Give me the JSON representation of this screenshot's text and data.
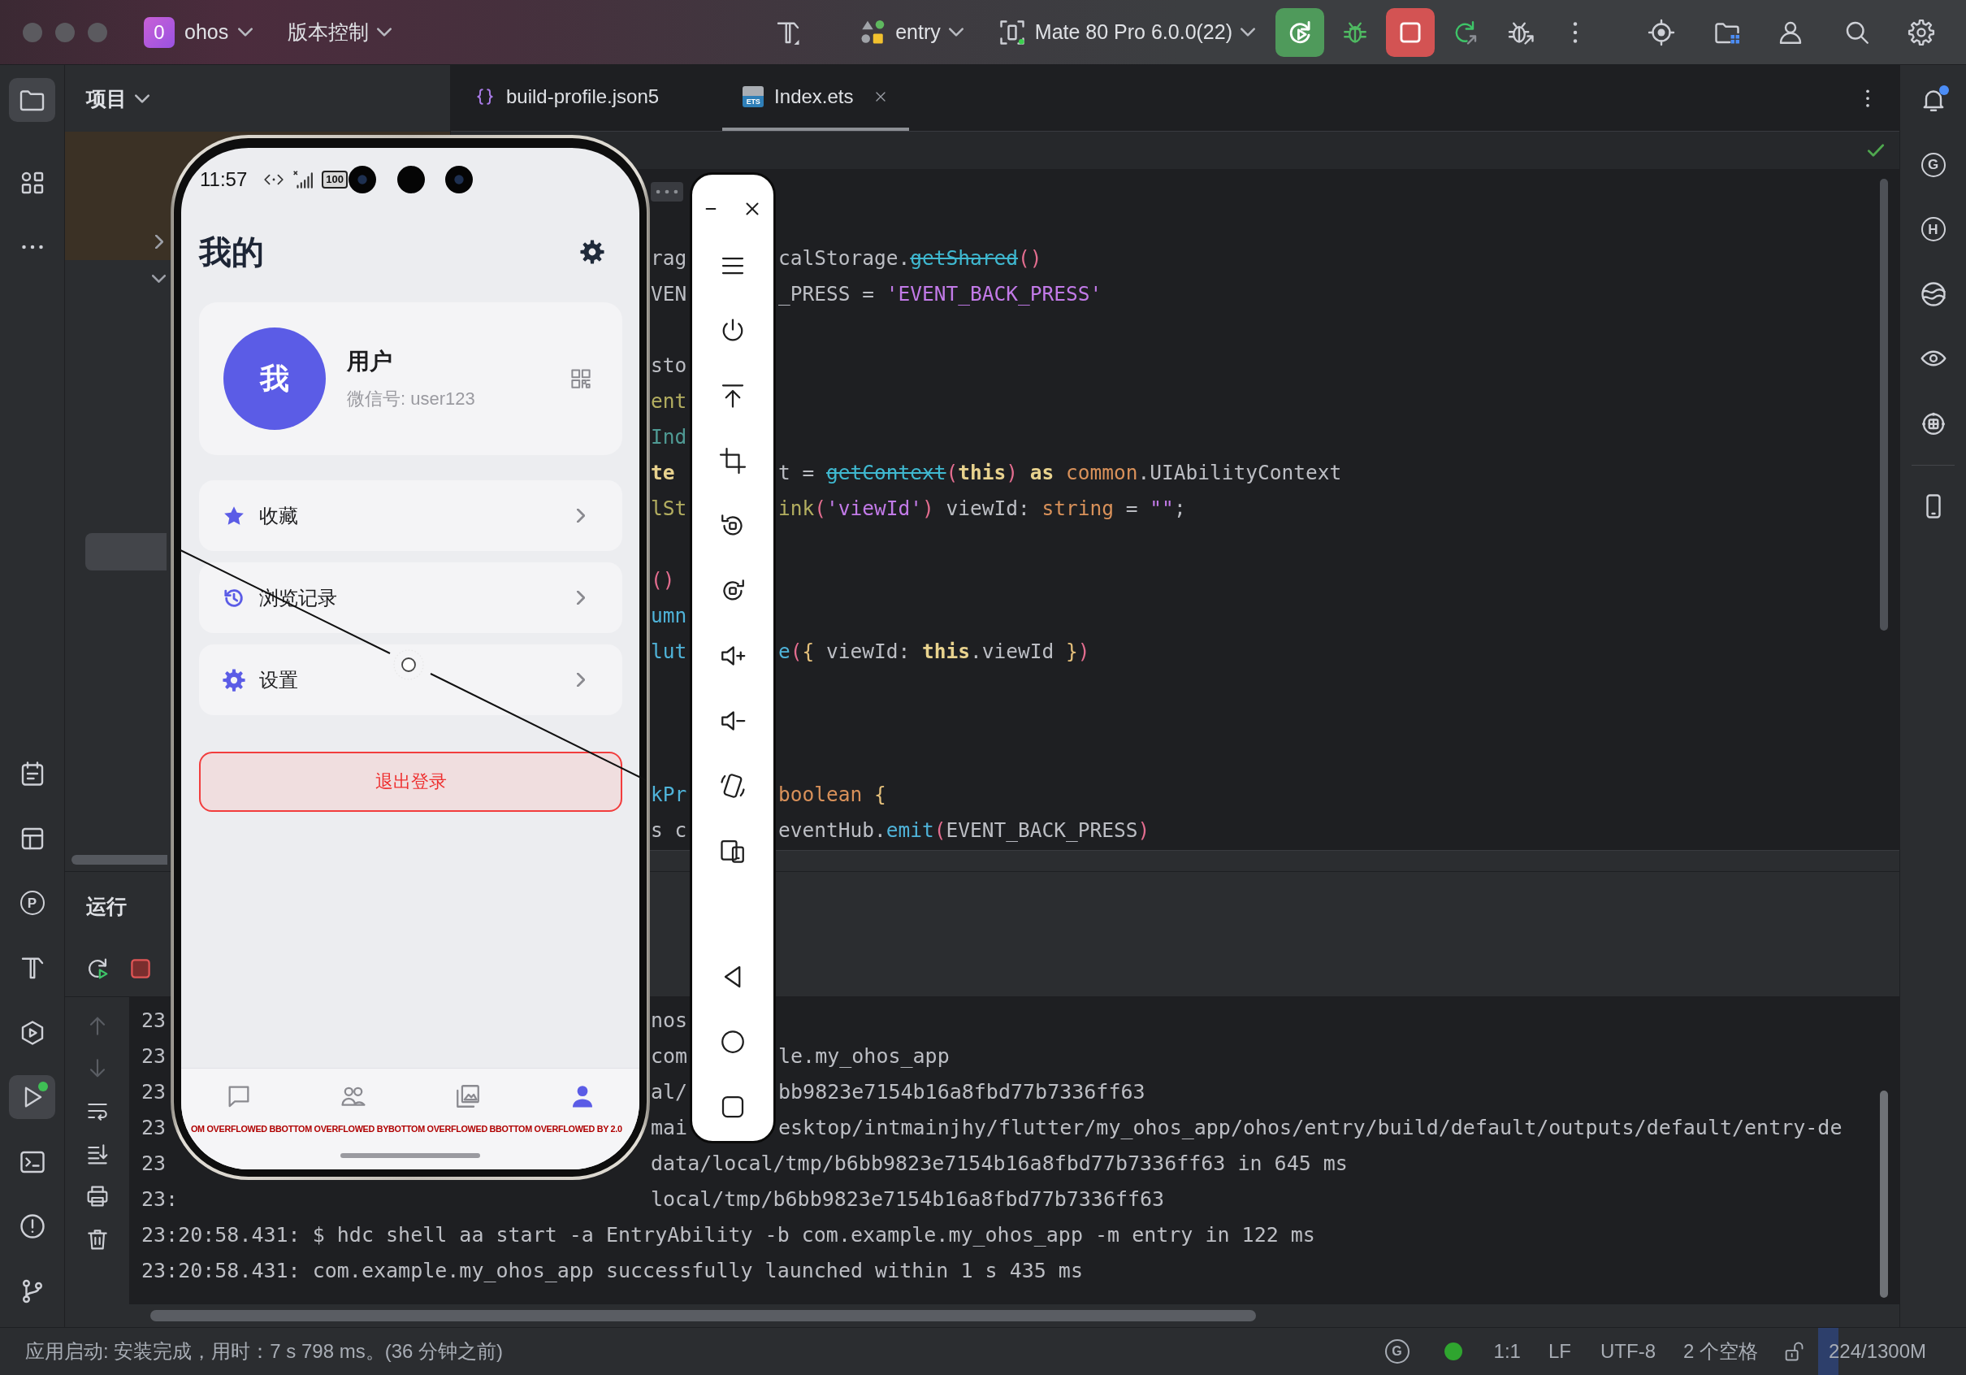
{
  "title_bar": {
    "project_badge": "0",
    "project": "ohos",
    "vcs": "版本控制",
    "run_config": "entry",
    "device": "Mate 80 Pro 6.0.0(22)"
  },
  "left_toolbar": {
    "top": [
      {
        "selected": true
      },
      {
        "selected": false
      },
      {
        "selected": false
      }
    ],
    "bottom": [
      {
        "selected": false,
        "badge": false
      },
      {
        "selected": false,
        "badge": false
      },
      {
        "selected": false,
        "badge": false,
        "letter": "P"
      },
      {
        "selected": false,
        "badge": false
      },
      {
        "selected": false,
        "badge": false
      },
      {
        "selected": true,
        "badge": true
      },
      {
        "selected": false,
        "badge": false
      },
      {
        "selected": false,
        "badge": false
      },
      {
        "selected": false,
        "badge": false
      }
    ]
  },
  "right_toolbar": [
    {
      "badge": true
    },
    {
      "badge": false,
      "letter": "G"
    },
    {
      "badge": false,
      "letter": "H"
    },
    {
      "badge": false
    },
    {
      "badge": false
    },
    {
      "badge": false
    },
    {
      "badge": false
    }
  ],
  "project_panel": {
    "title": "项目"
  },
  "editor_tabs": [
    {
      "kind": "json",
      "label": "build-profile.json5",
      "selected": false
    },
    {
      "kind": "ets",
      "file_type": "ETS",
      "label": "Index.ets",
      "selected": true
    }
  ],
  "code_lines": [
    {
      "kind": "code",
      "left": [
        {
          "text": "rag",
          "kind": "plain"
        }
      ],
      "right": [
        {
          "text": "calStorage.",
          "kind": "plain"
        },
        {
          "text": "getShared",
          "kind": "deprecated"
        },
        {
          "text": "()",
          "kind": "bracket"
        }
      ]
    },
    {
      "kind": "code",
      "left": [
        {
          "text": "VEN",
          "kind": "plain"
        }
      ],
      "right": [
        {
          "text": "_PRESS = ",
          "kind": "plain"
        },
        {
          "text": "'EVENT_BACK_PRESS'",
          "kind": "string"
        }
      ]
    },
    {
      "kind": "blank"
    },
    {
      "kind": "code",
      "left": [
        {
          "text": "sto",
          "kind": "plain"
        }
      ]
    },
    {
      "kind": "code",
      "left": [
        {
          "text": "ent",
          "kind": "decorator"
        }
      ]
    },
    {
      "kind": "code",
      "left": [
        {
          "text": "Ind",
          "kind": "struct"
        }
      ]
    },
    {
      "kind": "code",
      "left": [
        {
          "text": "te",
          "kind": "keyword"
        }
      ],
      "right": [
        {
          "text": "t = ",
          "kind": "plain"
        },
        {
          "text": "getContext",
          "kind": "deprecated"
        },
        {
          "text": "(",
          "kind": "bracket"
        },
        {
          "text": "this",
          "kind": "keyword"
        },
        {
          "text": ") ",
          "kind": "bracket"
        },
        {
          "text": "as ",
          "kind": "keyword"
        },
        {
          "text": "common",
          "kind": "type"
        },
        {
          "text": ".UIAbilityContext",
          "kind": "plain"
        }
      ]
    },
    {
      "kind": "code",
      "left": [
        {
          "text": "lSt",
          "kind": "decorator"
        }
      ],
      "right": [
        {
          "text": "ink",
          "kind": "decorator"
        },
        {
          "text": "(",
          "kind": "bracket"
        },
        {
          "text": "'viewId'",
          "kind": "string"
        },
        {
          "text": ")",
          "kind": "bracket"
        },
        {
          "text": " viewId: ",
          "kind": "plain"
        },
        {
          "text": "string",
          "kind": "type"
        },
        {
          "text": " = ",
          "kind": "plain"
        },
        {
          "text": "\"\"",
          "kind": "string"
        },
        {
          "text": ";",
          "kind": "plain"
        }
      ]
    },
    {
      "kind": "blank"
    },
    {
      "kind": "code",
      "left": [
        {
          "text": "()",
          "kind": "bracket"
        }
      ]
    },
    {
      "kind": "code",
      "left": [
        {
          "text": "umn",
          "kind": "function"
        }
      ]
    },
    {
      "kind": "code",
      "left": [
        {
          "text": "lut",
          "kind": "function"
        }
      ],
      "right": [
        {
          "text": "e",
          "kind": "function"
        },
        {
          "text": "(",
          "kind": "bracket"
        },
        {
          "text": "{",
          "kind": "brace"
        },
        {
          "text": " viewId: ",
          "kind": "plain"
        },
        {
          "text": "this",
          "kind": "keyword"
        },
        {
          "text": ".viewId ",
          "kind": "plain"
        },
        {
          "text": "}",
          "kind": "brace"
        },
        {
          "text": ")",
          "kind": "bracket"
        }
      ]
    },
    {
      "kind": "blank"
    },
    {
      "kind": "blank"
    },
    {
      "kind": "blank"
    },
    {
      "kind": "code",
      "left": [
        {
          "text": "kPr",
          "kind": "function"
        }
      ],
      "right": [
        {
          "text": "boolean ",
          "kind": "type"
        },
        {
          "text": "{",
          "kind": "brace"
        }
      ]
    },
    {
      "kind": "code",
      "left": [
        {
          "text": "s c",
          "kind": "plain"
        }
      ],
      "right": [
        {
          "text": "eventHub.",
          "kind": "plain"
        },
        {
          "text": "emit",
          "kind": "function"
        },
        {
          "text": "(",
          "kind": "bracket"
        },
        {
          "text": "EVENT_BACK_PRESS",
          "kind": "plain"
        },
        {
          "text": ")",
          "kind": "bracket"
        }
      ]
    }
  ],
  "run_panel": {
    "title": "运行",
    "tools": [
      {
        "disabled": true
      },
      {
        "disabled": true
      },
      {
        "disabled": false
      },
      {
        "disabled": false
      },
      {
        "disabled": false
      },
      {
        "disabled": false
      }
    ],
    "console_lines": [
      {
        "segments": [
          "23",
          "nos"
        ]
      },
      {
        "segments": [
          "23",
          "com",
          "le.my_ohos_app"
        ]
      },
      {
        "segments": [
          "23",
          "al/",
          "bb9823e7154b16a8fbd77b7336ff63"
        ]
      },
      {
        "segments": [
          "23",
          "mai",
          "esktop/intmainjhy/flutter/my_ohos_app/ohos/entry/build/default/outputs/default/entry-de"
        ]
      },
      {
        "segments": [
          "23",
          "data/local/tmp/b6bb9823e7154b16a8fbd77b7336ff63 in 645 ms"
        ]
      },
      {
        "segments": [
          "23:",
          "local/tmp/b6bb9823e7154b16a8fbd77b7336ff63"
        ]
      },
      {
        "segments": [
          "23:20:58.431: $ hdc shell aa start -a EntryAbility -b com.example.my_ohos_app -m entry in 122 ms"
        ]
      },
      {
        "segments": [
          "23:20:58.431: com.example.my_ohos_app successfully launched within 1 s 435 ms"
        ]
      }
    ]
  },
  "status_bar": {
    "message": "应用启动: 安装完成，用时：7 s 798 ms。(36 分钟之前)",
    "plugin": "G",
    "position": "1:1",
    "line_ending": "LF",
    "encoding": "UTF-8",
    "indent": "2 个空格",
    "memory": {
      "text": "224/1300M",
      "level": 0.17
    }
  },
  "emulator": {
    "status_time": "11:57",
    "battery": "100",
    "title": "我的",
    "profile": {
      "avatar": "我",
      "name": "用户",
      "account": "微信号: user123"
    },
    "menu": [
      {
        "label": "收藏"
      },
      {
        "label": "浏览记录"
      },
      {
        "label": "设置"
      }
    ],
    "logout": "退出登录",
    "bottom_nav": [
      {
        "selected": false
      },
      {
        "selected": false
      },
      {
        "selected": false
      },
      {
        "selected": true
      }
    ],
    "overflow_warnings": [
      "OM OVERFLOWED B",
      "BOTTOM OVERFLOWED BY",
      "BOTTOM OVERFLOWED B",
      "BOTTOM OVERFLOWED BY 2.0"
    ]
  }
}
